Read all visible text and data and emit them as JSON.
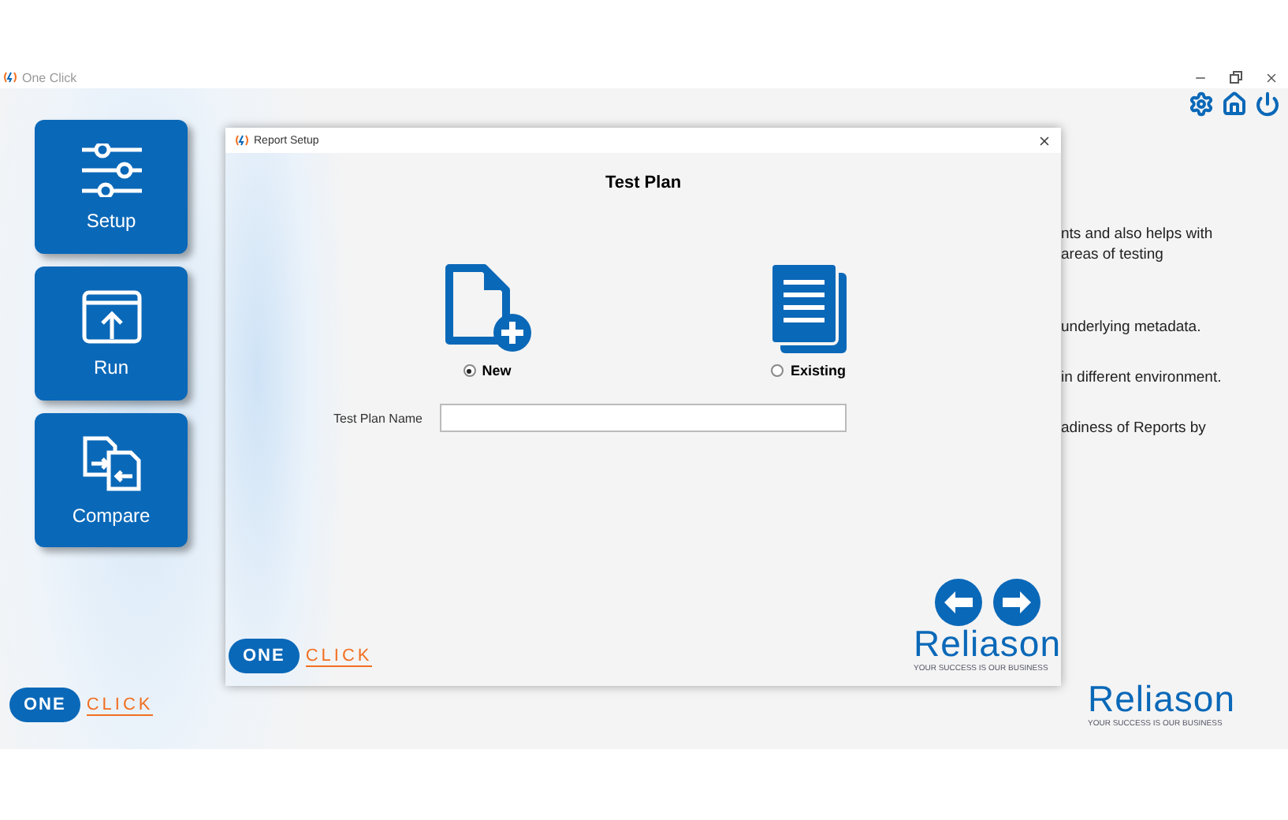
{
  "window": {
    "title": "One Click"
  },
  "sidebar": {
    "items": [
      {
        "label": "Setup",
        "kind": "setup"
      },
      {
        "label": "Run",
        "kind": "run"
      },
      {
        "label": "Compare",
        "kind": "compare"
      }
    ]
  },
  "dialog": {
    "title": "Report Setup",
    "heading": "Test Plan",
    "options": [
      {
        "label": "New",
        "kind": "new",
        "selected": true
      },
      {
        "label": "Existing",
        "kind": "existing",
        "selected": false
      }
    ],
    "field": {
      "label": "Test Plan Name"
    }
  },
  "background_text": [
    "nts  and also helps with",
    "areas of testing",
    "underlying metadata.",
    "in different environment.",
    "adiness of Reports by"
  ],
  "brand": {
    "one": "ONE",
    "click": "CLICK",
    "company": "Reliason",
    "tagline": "YOUR SUCCESS IS OUR BUSINESS"
  },
  "dialog_brand": {
    "one": "ONE",
    "click": "CLICK",
    "company": "Reliason",
    "tagline": "YOUR SUCCESS IS OUR BUSINESS"
  }
}
